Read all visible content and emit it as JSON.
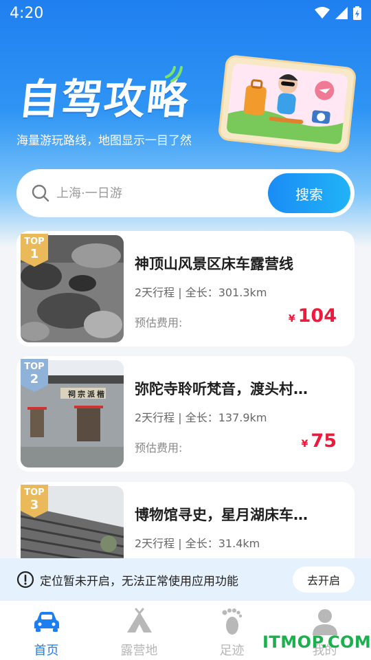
{
  "status": {
    "time": "4:20"
  },
  "hero": {
    "title": "自驾攻略",
    "subtitle": "海量游玩路线，地图显示一目了然"
  },
  "search": {
    "placeholder": "上海·一日游",
    "button_label": "搜索"
  },
  "routes": [
    {
      "badge_top": "TOP",
      "rank": "1",
      "title": "神顶山风景区床车露营线",
      "meta": "2天行程 | 全长：301.3km",
      "cost_label": "预估费用:",
      "currency": "¥",
      "price": "104"
    },
    {
      "badge_top": "TOP",
      "rank": "2",
      "title": "弥陀寺聆听梵音，渡头村…",
      "meta": "2天行程 | 全长：137.9km",
      "cost_label": "预估费用:",
      "currency": "¥",
      "price": "75",
      "thumb_sign": "祠宗派楷"
    },
    {
      "badge_top": "TOP",
      "rank": "3",
      "title": "博物馆寻史，星月湖床车…",
      "meta": "2天行程 | 全长：31.4km"
    }
  ],
  "location_notice": {
    "message": "定位暂未开启，无法正常使用应用功能",
    "button_label": "去开启"
  },
  "tabbar": [
    {
      "label": "首页",
      "icon": "car-icon",
      "active": true
    },
    {
      "label": "露营地",
      "icon": "tent-icon",
      "active": false
    },
    {
      "label": "足迹",
      "icon": "footprint-icon",
      "active": false
    },
    {
      "label": "我的",
      "icon": "user-icon",
      "active": false
    }
  ],
  "watermark": "ITMOP.COM",
  "colors": {
    "primary": "#1d7ef0",
    "price": "#f0193c",
    "badge_gold": "#e9b95a",
    "badge_blue": "#8fb2d8"
  }
}
